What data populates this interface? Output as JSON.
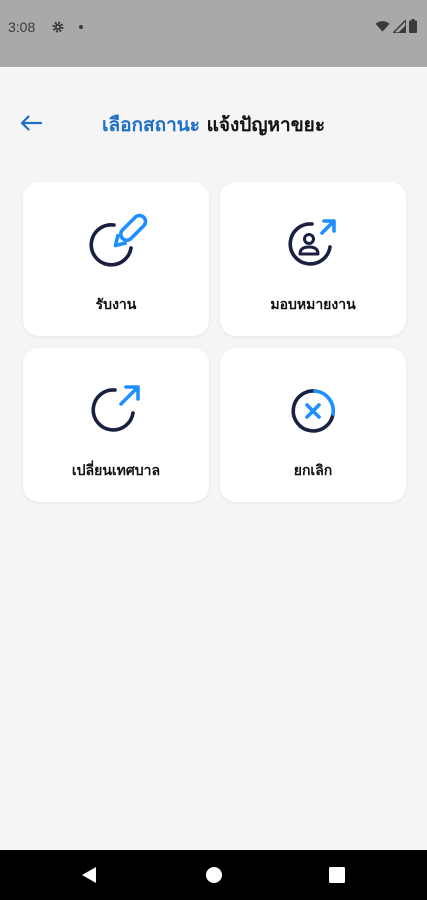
{
  "status_bar": {
    "time": "3:08",
    "icons": [
      "gear-icon",
      "dot-icon",
      "wifi-icon",
      "signal-icon",
      "battery-icon"
    ]
  },
  "header": {
    "back_icon": "arrow-left-icon",
    "title_accent": "เลือกสถานะ",
    "title_rest": " แจ้งปัญหาขยะ"
  },
  "colors": {
    "accent": "#1f6fc9",
    "icon_blue": "#1e8fff",
    "icon_navy": "#1a2040"
  },
  "actions": [
    {
      "label": "รับงาน",
      "icon": "edit-icon"
    },
    {
      "label": "มอบหมายงาน",
      "icon": "assign-user-icon"
    },
    {
      "label": "เปลี่ยนเทศบาล",
      "icon": "external-share-icon"
    },
    {
      "label": "ยกเลิก",
      "icon": "cancel-icon"
    }
  ],
  "nav_bar": {
    "buttons": [
      "back-triangle-icon",
      "home-circle-icon",
      "recents-square-icon"
    ]
  }
}
